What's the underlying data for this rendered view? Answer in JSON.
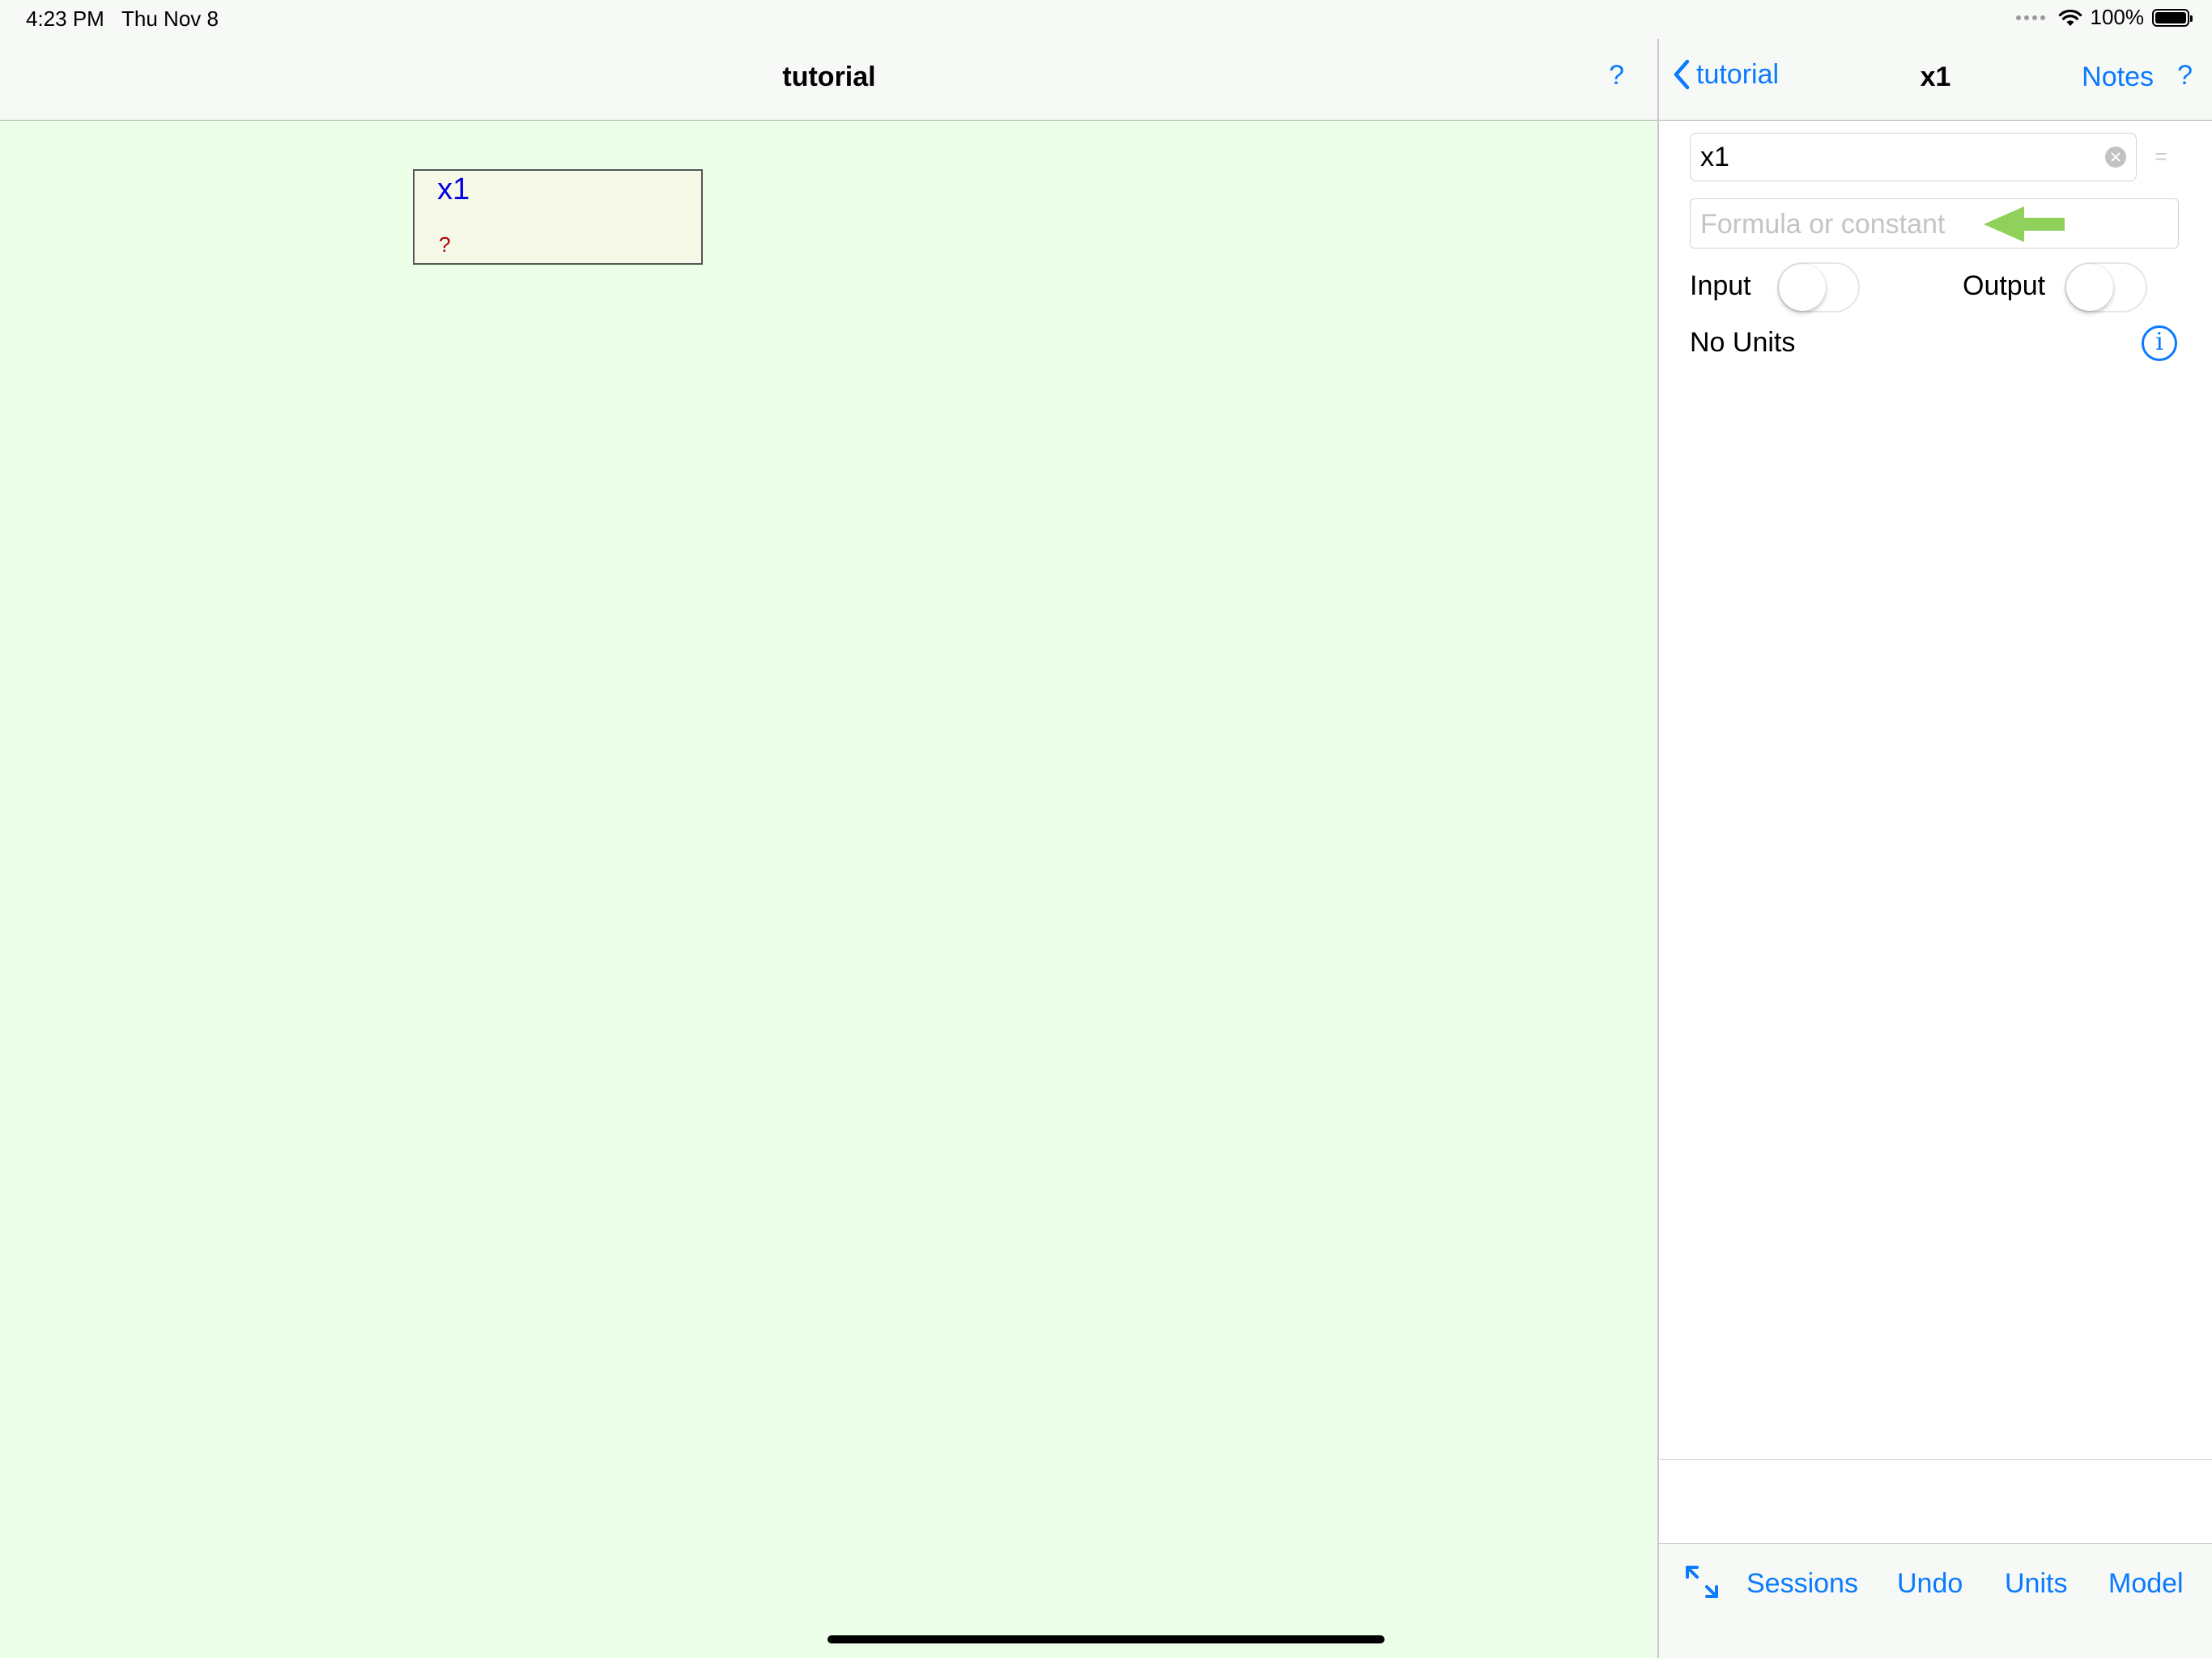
{
  "status_bar": {
    "time": "4:23 PM",
    "date": "Thu Nov 8",
    "battery_percent": "100%",
    "icons": [
      "cellular-signal-icon",
      "wifi-icon",
      "battery-icon"
    ]
  },
  "left_panel": {
    "title": "tutorial",
    "help_label": "?",
    "variable_box": {
      "name": "x1",
      "value": "?"
    }
  },
  "right_panel": {
    "back_label": "tutorial",
    "title": "x1",
    "notes_label": "Notes",
    "help_label": "?",
    "name_field_value": "x1",
    "equals_label": "=",
    "formula_placeholder": "Formula or constant",
    "input_toggle_label": "Input",
    "input_toggle_on": false,
    "output_toggle_label": "Output",
    "output_toggle_on": false,
    "units_label": "No Units",
    "info_icon_glyph": "i",
    "toolbar": {
      "expand_icon": "expand-arrows-icon",
      "sessions_label": "Sessions",
      "undo_label": "Undo",
      "units_label": "Units",
      "model_label": "Model"
    }
  },
  "colors": {
    "accent": "#0a7aff",
    "canvas_background": "#ecffe9",
    "variable_name": "#0000e0",
    "variable_value": "#b00000",
    "hint_arrow": "#8fd15a"
  }
}
